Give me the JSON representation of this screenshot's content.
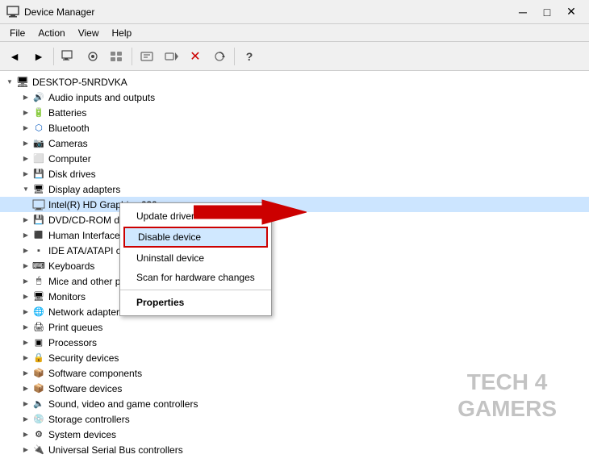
{
  "titleBar": {
    "icon": "device-manager-icon",
    "title": "Device Manager",
    "buttons": [
      "minimize",
      "maximize",
      "close"
    ]
  },
  "menuBar": {
    "items": [
      "File",
      "Action",
      "View",
      "Help"
    ]
  },
  "toolbar": {
    "buttons": [
      "back",
      "forward",
      "up",
      "show-hidden",
      "display-devices-by-type",
      "display-devices-by-connection",
      "display-resources-by-type",
      "display-resources-by-connection",
      "properties",
      "update-driver",
      "uninstall",
      "scan-changes",
      "help"
    ]
  },
  "tree": {
    "rootLabel": "DESKTOP-5NRDVKA",
    "items": [
      {
        "id": "audio",
        "label": "Audio inputs and outputs",
        "indent": 1,
        "icon": "audio",
        "expandable": true,
        "expanded": false
      },
      {
        "id": "batteries",
        "label": "Batteries",
        "indent": 1,
        "icon": "battery",
        "expandable": true,
        "expanded": false
      },
      {
        "id": "bluetooth",
        "label": "Bluetooth",
        "indent": 1,
        "icon": "bluetooth",
        "expandable": true,
        "expanded": false
      },
      {
        "id": "cameras",
        "label": "Cameras",
        "indent": 1,
        "icon": "camera",
        "expandable": true,
        "expanded": false
      },
      {
        "id": "computer",
        "label": "Computer",
        "indent": 1,
        "icon": "computer",
        "expandable": true,
        "expanded": false
      },
      {
        "id": "diskdrives",
        "label": "Disk drives",
        "indent": 1,
        "icon": "disk",
        "expandable": true,
        "expanded": false
      },
      {
        "id": "displayadapters",
        "label": "Display adapters",
        "indent": 1,
        "icon": "display",
        "expandable": true,
        "expanded": true
      },
      {
        "id": "intel-graphics",
        "label": "Intel(R) HD Graphics 620",
        "indent": 2,
        "icon": "device",
        "expandable": false,
        "expanded": false,
        "selected": true
      },
      {
        "id": "dvdrom",
        "label": "DVD/CD-ROM drives",
        "indent": 1,
        "icon": "disk",
        "expandable": true,
        "expanded": false
      },
      {
        "id": "humaninterface",
        "label": "Human Interface Devices",
        "indent": 1,
        "icon": "device",
        "expandable": true,
        "expanded": false
      },
      {
        "id": "ideata",
        "label": "IDE ATA/ATAPI controllers",
        "indent": 1,
        "icon": "device",
        "expandable": true,
        "expanded": false
      },
      {
        "id": "keyboards",
        "label": "Keyboards",
        "indent": 1,
        "icon": "keyboard",
        "expandable": true,
        "expanded": false
      },
      {
        "id": "miceother",
        "label": "Mice and other pointing devices",
        "indent": 1,
        "icon": "mouse",
        "expandable": true,
        "expanded": false
      },
      {
        "id": "monitors",
        "label": "Monitors",
        "indent": 1,
        "icon": "monitor",
        "expandable": true,
        "expanded": false
      },
      {
        "id": "networkadapters",
        "label": "Network adapters",
        "indent": 1,
        "icon": "network",
        "expandable": true,
        "expanded": false
      },
      {
        "id": "printqueues",
        "label": "Print queues",
        "indent": 1,
        "icon": "print",
        "expandable": true,
        "expanded": false
      },
      {
        "id": "processors",
        "label": "Processors",
        "indent": 1,
        "icon": "processor",
        "expandable": true,
        "expanded": false
      },
      {
        "id": "securitydevices",
        "label": "Security devices",
        "indent": 1,
        "icon": "security",
        "expandable": true,
        "expanded": false
      },
      {
        "id": "softwarecomponents",
        "label": "Software components",
        "indent": 1,
        "icon": "software",
        "expandable": true,
        "expanded": false
      },
      {
        "id": "softwaredevices",
        "label": "Software devices",
        "indent": 1,
        "icon": "software",
        "expandable": true,
        "expanded": false
      },
      {
        "id": "soundvideo",
        "label": "Sound, video and game controllers",
        "indent": 1,
        "icon": "sound",
        "expandable": true,
        "expanded": false
      },
      {
        "id": "storagecontrollers",
        "label": "Storage controllers",
        "indent": 1,
        "icon": "storage",
        "expandable": true,
        "expanded": false
      },
      {
        "id": "systemdevices",
        "label": "System devices",
        "indent": 1,
        "icon": "system",
        "expandable": true,
        "expanded": false
      },
      {
        "id": "usb",
        "label": "Universal Serial Bus controllers",
        "indent": 1,
        "icon": "usb",
        "expandable": true,
        "expanded": false
      }
    ]
  },
  "contextMenu": {
    "items": [
      {
        "id": "update-driver",
        "label": "Update driver",
        "bold": false,
        "separator": false
      },
      {
        "id": "disable-device",
        "label": "Disable device",
        "bold": false,
        "separator": false,
        "highlighted": true
      },
      {
        "id": "uninstall-device",
        "label": "Uninstall device",
        "bold": false,
        "separator": false
      },
      {
        "id": "scan-hardware",
        "label": "Scan for hardware changes",
        "bold": false,
        "separator": true
      },
      {
        "id": "properties",
        "label": "Properties",
        "bold": true,
        "separator": false
      }
    ]
  },
  "watermark": {
    "line1": "TECH 4",
    "line2": "GAMERS"
  }
}
